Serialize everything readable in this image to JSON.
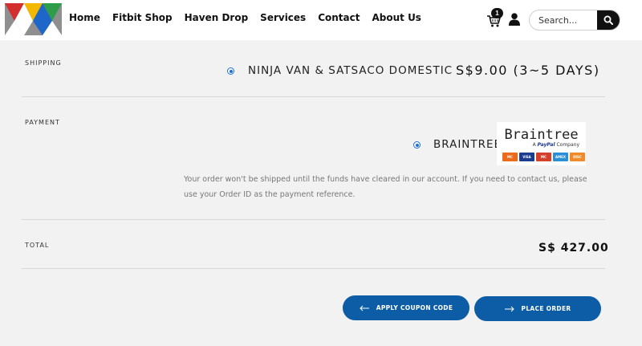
{
  "header": {
    "nav": [
      "Home",
      "Fitbit Shop",
      "Haven Drop",
      "Services",
      "Contact",
      "About Us"
    ],
    "cart_count": "1",
    "search": {
      "placeholder": "Search..."
    },
    "icons": {
      "cart": "cart-icon",
      "user": "user-icon",
      "search": "search-icon",
      "logo": "mountain-logo"
    },
    "logo_colors": [
      "#d32f2f",
      "#1e66c8",
      "#2e9d4a",
      "#f5b800",
      "#9e9e9e"
    ]
  },
  "shipping": {
    "label": "SHIPPING",
    "method": "NINJA VAN & SATSACO DOMESTIC",
    "price": "S$9.00 (3~5 DAYS)"
  },
  "payment": {
    "label": "PAYMENT",
    "method": "BRAINTREE",
    "logo_title": "Braintree",
    "logo_subtitle_prefix": "A",
    "logo_subtitle_brand": "PayPal",
    "logo_subtitle_suffix": "Company",
    "cards": [
      "MC",
      "VISA",
      "MC",
      "AMEX",
      "DISC"
    ],
    "note": "Your order won't be shipped until the funds have cleared in our account. If you need to contact us, please use your Order ID as the payment reference."
  },
  "total": {
    "label": "TOTAL",
    "value": "S$ 427.00"
  },
  "actions": {
    "coupon_label": "APPLY COUPON CODE",
    "place_order_label": "PLACE ORDER"
  },
  "colors": {
    "accent": "#0d5da6",
    "radio": "#1f6fd6",
    "background": "#f2f2f2"
  }
}
